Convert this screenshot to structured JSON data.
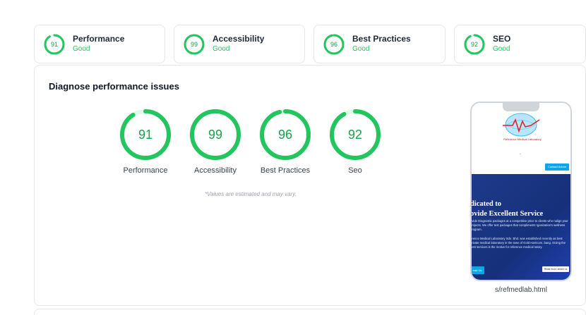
{
  "summary_cards": [
    {
      "score": "91",
      "title": "Performance",
      "status": "Good"
    },
    {
      "score": "99",
      "title": "Accessibility",
      "status": "Good"
    },
    {
      "score": "96",
      "title": "Best Practices",
      "status": "Good"
    },
    {
      "score": "92",
      "title": "SEO",
      "status": "Good"
    }
  ],
  "panel": {
    "title": "Diagnose performance issues",
    "gauges": [
      {
        "score": "91",
        "label": "Performance",
        "fraction": 0.91
      },
      {
        "score": "99",
        "label": "Accessibility",
        "fraction": 0.99
      },
      {
        "score": "96",
        "label": "Best Practices",
        "fraction": 0.96
      },
      {
        "score": "92",
        "label": "Seo",
        "fraction": 0.92
      }
    ],
    "note": "*Values are estimated and may vary."
  },
  "preview": {
    "logo_caption": "Reference Medical Laboratory",
    "contact_button": "Contact Admin",
    "hero_title_1": "dicated to",
    "hero_title_2": "ovide Excellent Service",
    "hero_paragraph": "ovide Diagnostic packages at a competitive price to clients who nalign your projects. We offer test packages that compliments rganization's wellness program.",
    "hero_paragraph_2": "erence Medical Laboratory Sdn. Bhd. was established recently as best private medical laboratory in the town of Gold Harricom. bang. Giving the best services is the motive for reference medical ratory.",
    "hero_button_1": "ead Us",
    "hero_button_2": "Read more about us",
    "url": "s/refmedlab.html"
  },
  "colors": {
    "good": "#22c55e",
    "score_text": "#16a34a",
    "track": "#dcfce7"
  }
}
